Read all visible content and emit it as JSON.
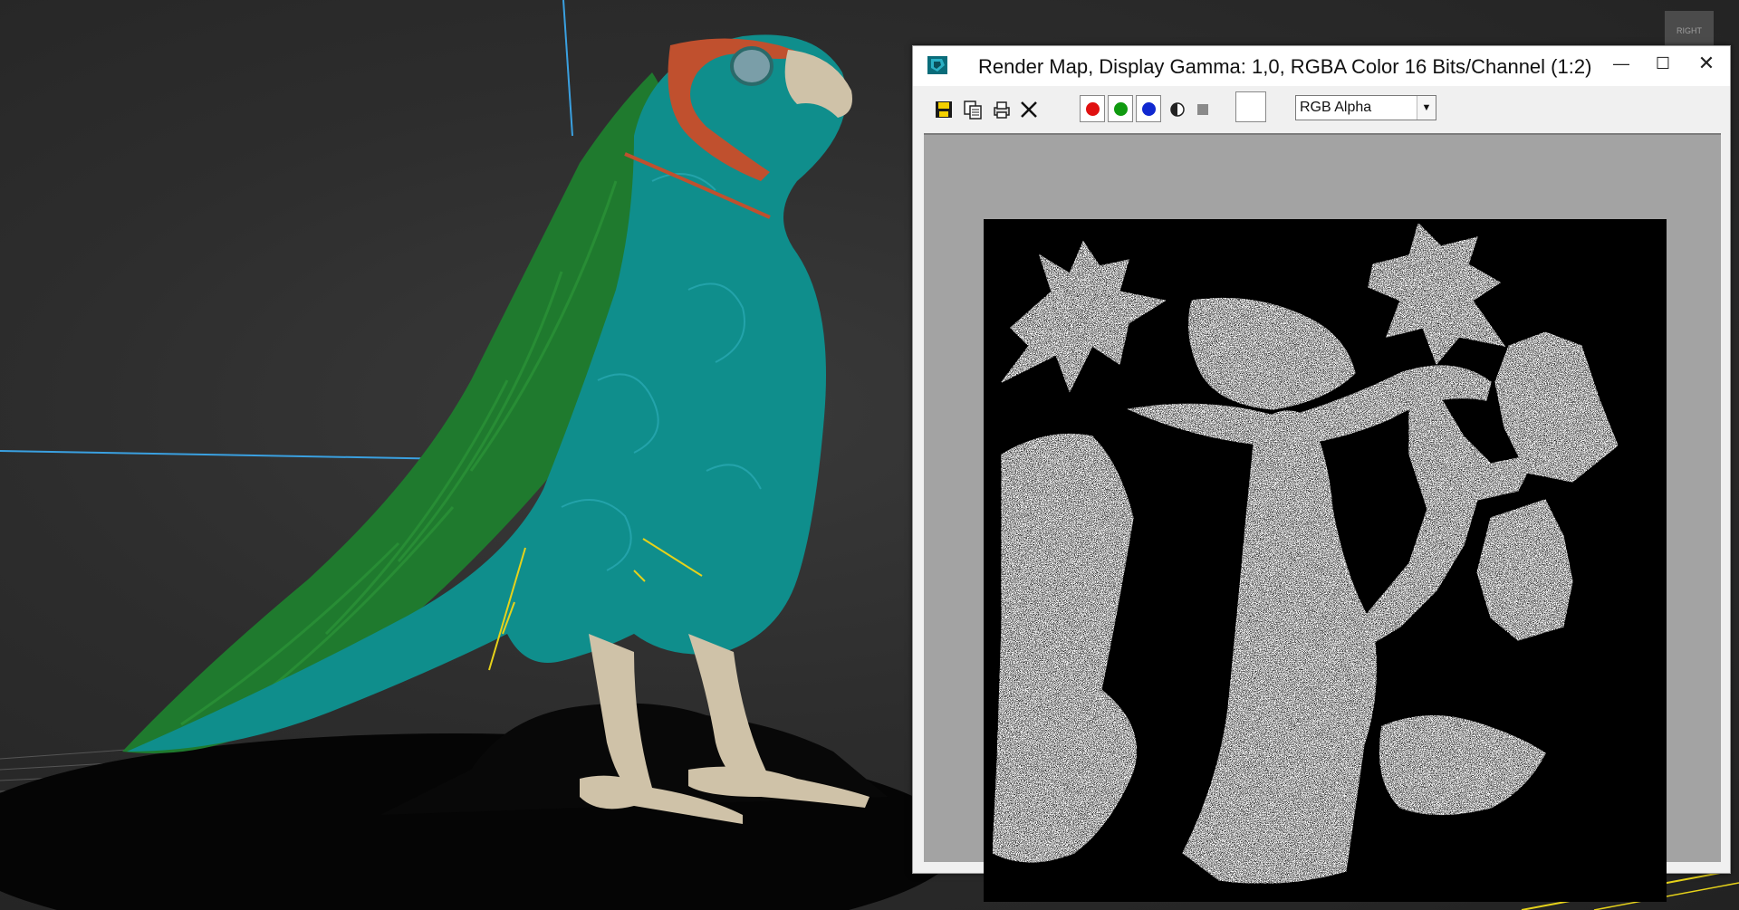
{
  "viewport": {
    "label": "RIGHT"
  },
  "render_window": {
    "title": "Render Map, Display Gamma: 1,0, RGBA Color 16 Bits/Channel (1:2)",
    "minimize_glyph": "—",
    "maximize_glyph": "☐",
    "close_glyph": "✕",
    "toolbar": {
      "channel_select": {
        "value": "RGB Alpha",
        "arrow": "▼"
      },
      "channel_colors": {
        "red": "#e01010",
        "green": "#109a10",
        "blue": "#1028d0"
      }
    }
  },
  "colors": {
    "body": "#0f8e8c",
    "wing": "#1f7a2e",
    "face_marking": "#c0502e",
    "beak_feet": "#cfc2a8",
    "gizmo_blue": "#3aa0e0",
    "gizmo_yellow": "#e6d21a"
  }
}
